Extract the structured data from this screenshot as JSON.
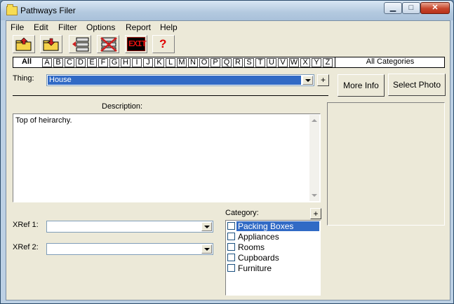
{
  "window": {
    "title": "Pathways Filer"
  },
  "menu": [
    "File",
    "Edit",
    "Filter",
    "Options",
    "Report",
    "Help"
  ],
  "toolbar": {
    "open_icon": "open-folder-icon",
    "save_icon": "save-folder-icon",
    "list_icon": "list-icon",
    "delete_icon": "delete-list-icon",
    "exit_label": "EXIT",
    "help_label": "?"
  },
  "alpha_tabs": {
    "all": "All",
    "letters": [
      "A",
      "B",
      "C",
      "D",
      "E",
      "F",
      "G",
      "H",
      "I",
      "J",
      "K",
      "L",
      "M",
      "N",
      "O",
      "P",
      "Q",
      "R",
      "S",
      "T",
      "U",
      "V",
      "W",
      "X",
      "Y",
      "Z"
    ],
    "all_categories": "All Categories"
  },
  "thing": {
    "label": "Thing:",
    "value": "House",
    "add": "+"
  },
  "buttons": {
    "more_info": "More Info",
    "select_photo": "Select Photo"
  },
  "description": {
    "label": "Description:",
    "text": "Top of heirarchy."
  },
  "xref1": {
    "label": "XRef 1:",
    "value": ""
  },
  "xref2": {
    "label": "XRef 2:",
    "value": ""
  },
  "category": {
    "label": "Category:",
    "add": "+",
    "items": [
      {
        "label": "Packing Boxes",
        "checked": false,
        "selected": true
      },
      {
        "label": "Appliances",
        "checked": false,
        "selected": false
      },
      {
        "label": "Rooms",
        "checked": false,
        "selected": false
      },
      {
        "label": "Cupboards",
        "checked": false,
        "selected": false
      },
      {
        "label": "Furniture",
        "checked": false,
        "selected": false
      }
    ]
  },
  "colors": {
    "selection": "#316ac5",
    "exit_bg": "#c00000",
    "help_red": "#e00000"
  }
}
